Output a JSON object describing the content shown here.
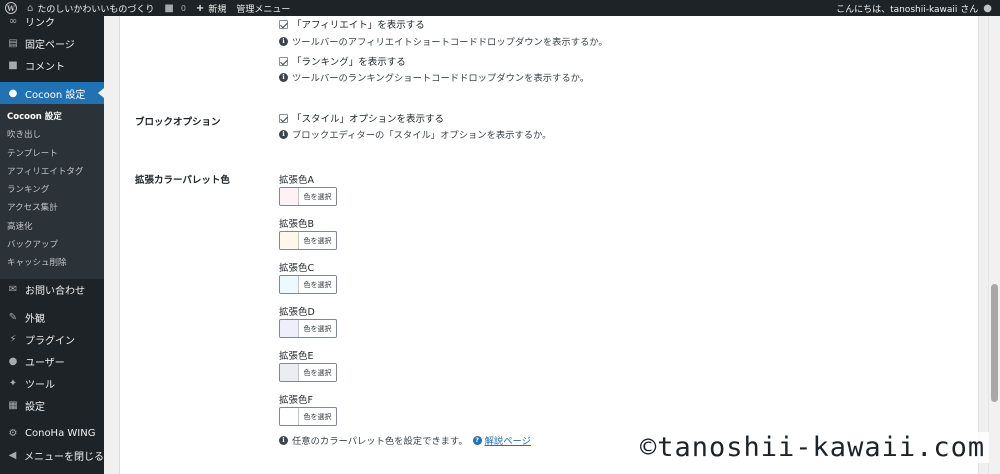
{
  "adminbar": {
    "site_name": "たのしいかわいいものづくり",
    "comments_count": "0",
    "new_label": "新規",
    "manage_menu_label": "管理メニュー",
    "greeting": "こんにちは、tanoshii-kawaii さん"
  },
  "sidebar": {
    "top_items": [
      {
        "label": "リンク",
        "icon": "link-icon"
      },
      {
        "label": "固定ページ",
        "icon": "page-icon"
      },
      {
        "label": "コメント",
        "icon": "comment-icon"
      }
    ],
    "current_item": {
      "label": "Cocoon 設定",
      "icon": "cocoon-icon"
    },
    "submenu": [
      "Cocoon 設定",
      "吹き出し",
      "テンプレート",
      "アフィリエイトタグ",
      "ランキング",
      "アクセス集計",
      "高速化",
      "バックアップ",
      "キャッシュ削除"
    ],
    "contact_item": {
      "label": "お問い合わせ",
      "icon": "mail-icon"
    },
    "bottom_items": [
      {
        "label": "外観",
        "icon": "brush-icon"
      },
      {
        "label": "プラグイン",
        "icon": "plugin-icon"
      },
      {
        "label": "ユーザー",
        "icon": "user-icon"
      },
      {
        "label": "ツール",
        "icon": "wrench-icon"
      },
      {
        "label": "設定",
        "icon": "settings-icon"
      }
    ],
    "conoha_item": {
      "label": "ConoHa WING",
      "icon": "gear-icon"
    },
    "collapse_item": {
      "label": "メニューを閉じる",
      "icon": "collapse-icon"
    }
  },
  "content": {
    "affiliate_checkbox": "「アフィリエイト」を表示する",
    "affiliate_desc": "ツールバーのアフィリエイトショートコードドロップダウンを表示するか。",
    "ranking_checkbox": "「ランキング」を表示する",
    "ranking_desc": "ツールバーのランキングショートコードドロップダウンを表示するか。",
    "block_option_label": "ブロックオプション",
    "style_checkbox": "「スタイル」オプションを表示する",
    "style_desc": "ブロックエディターの「スタイル」オプションを表示するか。",
    "palette_label": "拡張カラーパレット色",
    "pick_color_label": "色を選択",
    "palette_colors": [
      {
        "label": "拡張色A",
        "color": "#fff2f5"
      },
      {
        "label": "拡張色B",
        "color": "#fff8e8"
      },
      {
        "label": "拡張色C",
        "color": "#eef8ff"
      },
      {
        "label": "拡張色D",
        "color": "#eeeffa"
      },
      {
        "label": "拡張色E",
        "color": "#ecedf0"
      },
      {
        "label": "拡張色F",
        "color": "#ffffff"
      }
    ],
    "palette_desc": "任意のカラーパレット色を設定できます。",
    "help_link": "解説ページ"
  },
  "watermark": "©tanoshii-kawaii.com",
  "colors": {
    "admin_dark": "#1d2327",
    "submenu_bg": "#2c3338",
    "accent_blue": "#2271b1"
  }
}
